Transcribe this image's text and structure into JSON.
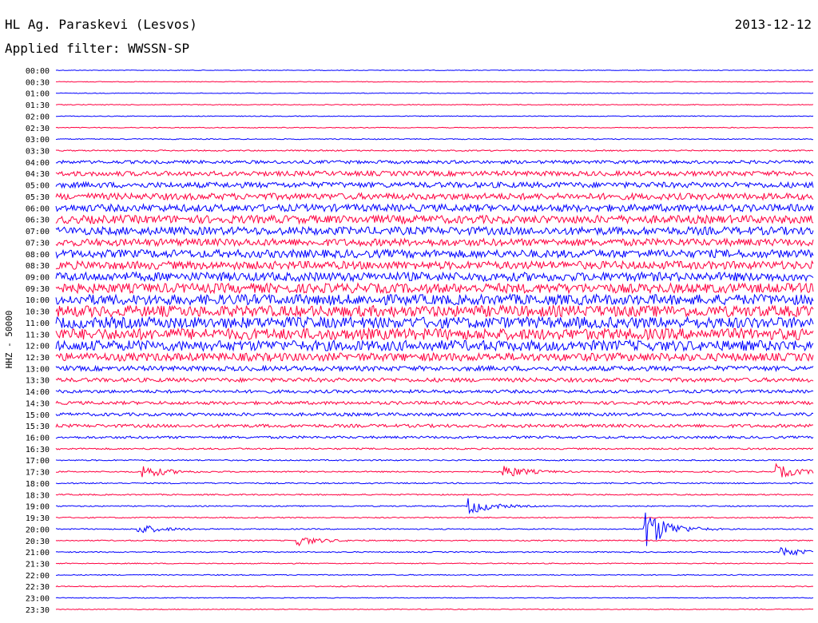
{
  "header": {
    "station": "HL Ag. Paraskevi (Lesvos)",
    "filter": "Applied filter: WWSSN-SP",
    "date": "2013-12-12"
  },
  "chart_data": {
    "type": "line",
    "title": "HL Ag. Paraskevi (Lesvos)",
    "subtitle": "Applied filter: WWSSN-SP",
    "ylabel": "HHZ - 50000",
    "row_labels": [
      "00:00",
      "00:30",
      "01:00",
      "01:30",
      "02:00",
      "02:30",
      "03:00",
      "03:30",
      "04:00",
      "04:30",
      "05:00",
      "05:30",
      "06:00",
      "06:30",
      "07:00",
      "07:30",
      "08:00",
      "08:30",
      "09:00",
      "09:30",
      "10:00",
      "10:30",
      "11:00",
      "11:30",
      "12:00",
      "12:30",
      "13:00",
      "13:30",
      "14:00",
      "14:30",
      "15:00",
      "15:30",
      "16:00",
      "16:30",
      "17:00",
      "17:30",
      "18:00",
      "18:30",
      "19:00",
      "19:30",
      "20:00",
      "20:30",
      "21:00",
      "21:30",
      "22:00",
      "22:30",
      "23:00",
      "23:30"
    ],
    "series_colors": [
      "#0000ff",
      "#ff0040"
    ],
    "noise_level_per_row": [
      0.4,
      0.4,
      0.4,
      0.5,
      0.5,
      0.5,
      0.6,
      0.8,
      2.0,
      3.0,
      3.5,
      4.0,
      4.5,
      5.0,
      5.0,
      4.5,
      5.0,
      5.0,
      5.5,
      6.0,
      6.5,
      7.0,
      7.0,
      7.0,
      6.5,
      5.0,
      3.0,
      2.5,
      2.0,
      2.0,
      2.0,
      2.0,
      1.5,
      1.0,
      0.8,
      0.8,
      0.8,
      0.8,
      0.7,
      0.7,
      0.7,
      0.7,
      0.7,
      0.6,
      0.6,
      0.6,
      0.5,
      0.5
    ],
    "events": [
      {
        "row": 35,
        "minute": 3.5,
        "amplitude": 8
      },
      {
        "row": 35,
        "minute": 17.8,
        "amplitude": 8
      },
      {
        "row": 35,
        "minute": 28.6,
        "amplitude": 8
      },
      {
        "row": 38,
        "minute": 16.4,
        "amplitude": 10
      },
      {
        "row": 40,
        "minute": 3.3,
        "amplitude": 6
      },
      {
        "row": 40,
        "minute": 23.4,
        "amplitude": 25
      },
      {
        "row": 41,
        "minute": 9.6,
        "amplitude": 6
      },
      {
        "row": 42,
        "minute": 28.8,
        "amplitude": 6
      }
    ]
  }
}
